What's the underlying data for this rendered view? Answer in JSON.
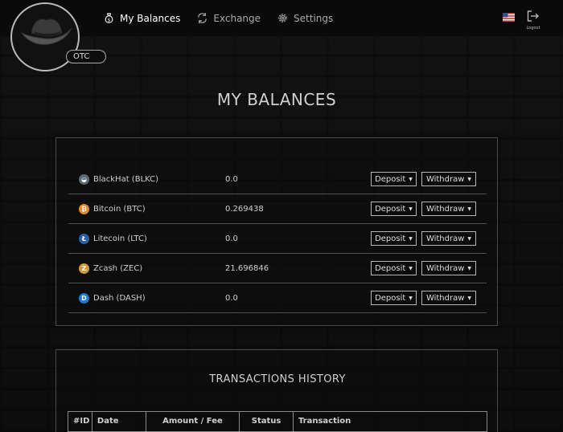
{
  "header": {
    "otc_badge": "OTC",
    "nav": [
      {
        "label": "My Balances",
        "icon": "money-bag-icon",
        "active": true
      },
      {
        "label": "Exchange",
        "icon": "exchange-icon",
        "active": false
      },
      {
        "label": "Settings",
        "icon": "gear-icon",
        "active": false
      }
    ],
    "language_flag": "us-flag-icon",
    "logout_label": "Logout"
  },
  "page_title": "MY BALANCES",
  "balances": [
    {
      "name": "BlackHat (BLKC)",
      "balance": "0.0",
      "icon": "blackhat-coin-icon",
      "icon_color": "#3a7fa3",
      "icon_glyph": "◒"
    },
    {
      "name": "Bitcoin (BTC)",
      "balance": "0.269438",
      "icon": "bitcoin-icon",
      "icon_color": "#e58a2b",
      "icon_glyph": "₿"
    },
    {
      "name": "Litecoin (LTC)",
      "balance": "0.0",
      "icon": "litecoin-icon",
      "icon_color": "#2d5fa5",
      "icon_glyph": "Ł"
    },
    {
      "name": "Zcash (ZEC)",
      "balance": "21.696846",
      "icon": "zcash-icon",
      "icon_color": "#d09b3e",
      "icon_glyph": "Z"
    },
    {
      "name": "Dash (DASH)",
      "balance": "0.0",
      "icon": "dash-icon",
      "icon_color": "#1d7ad2",
      "icon_glyph": "D"
    }
  ],
  "buttons": {
    "deposit": "Deposit",
    "withdraw": "Withdraw"
  },
  "transactions": {
    "title": "TRANSACTIONS HISTORY",
    "columns": [
      "#ID",
      "Date",
      "Amount / Fee",
      "Status",
      "Transaction"
    ]
  }
}
